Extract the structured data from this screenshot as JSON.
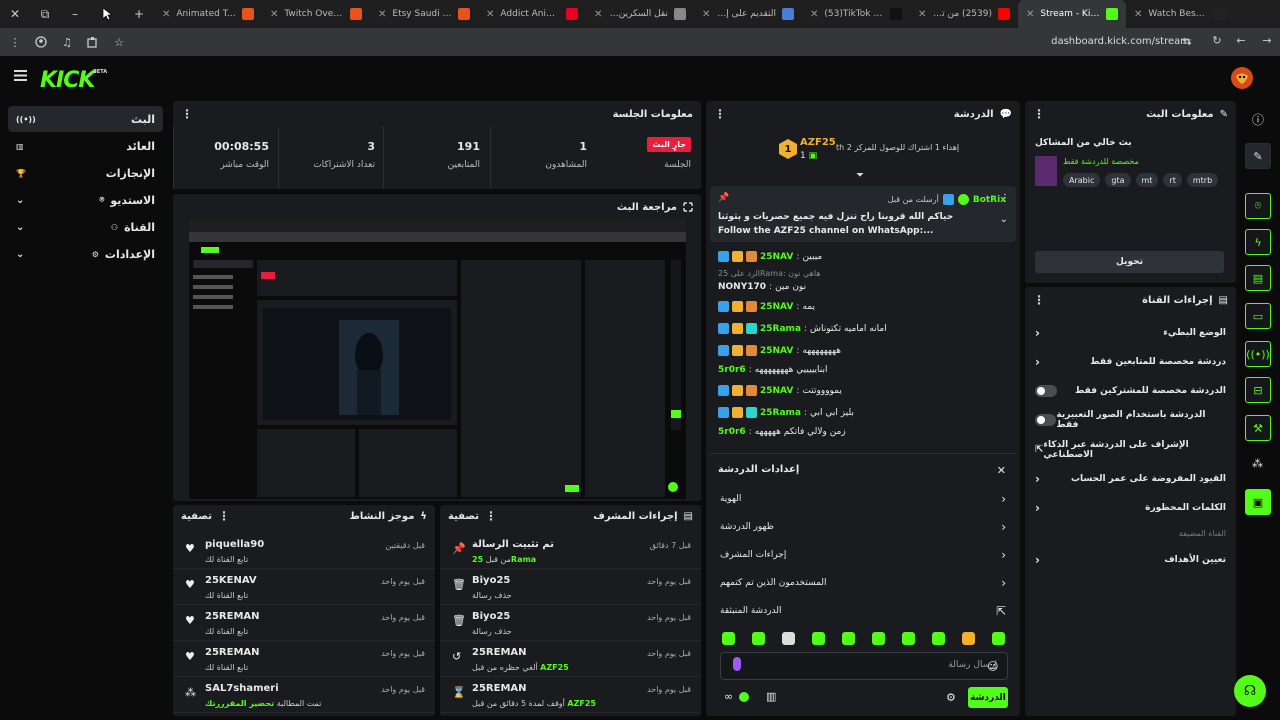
{
  "browser": {
    "tabs": [
      {
        "title": "Animated Twitch",
        "fav": "#e8521b",
        "active": false,
        "ltr": true
      },
      {
        "title": "Twitch Overlays -",
        "fav": "#e8521b",
        "active": false,
        "ltr": true
      },
      {
        "title": "Etsy Saudi Arabia",
        "fav": "#e8521b",
        "active": false,
        "ltr": true
      },
      {
        "title": "Addict Animated",
        "fav": "#e60023",
        "active": false,
        "ltr": true
      },
      {
        "title": "نقل السكرين للشا",
        "fav": "#888888",
        "active": false,
        "ltr": false
      },
      {
        "title": "التقديم على إدارة",
        "fav": "#4a7dd8",
        "active": false,
        "ltr": false
      },
      {
        "title": "(53)TikTok - Make",
        "fav": "#111111",
        "active": false,
        "ltr": true
      },
      {
        "title": "(2539) من تهمة الـ",
        "fav": "#ff0000",
        "active": false,
        "ltr": false
      },
      {
        "title": "Stream - Kick Da",
        "fav": "#53fc18",
        "active": true,
        "ltr": true
      },
      {
        "title": "Watch Best New M",
        "fav": "#222222",
        "active": false,
        "ltr": true
      }
    ],
    "url": "dashboard.kick.com/stream"
  },
  "header": {
    "logo": "KICK",
    "beta": "BETA"
  },
  "nav": {
    "items": [
      {
        "label": "البث",
        "icon": "broadcast-icon",
        "active": true
      },
      {
        "label": "العائد",
        "icon": "wallet-icon",
        "active": false
      },
      {
        "label": "الإنجازات",
        "icon": "trophy-icon",
        "active": false
      },
      {
        "label": "الاستديو",
        "icon": "studio-icon",
        "active": false,
        "expand": true
      },
      {
        "label": "القناة",
        "icon": "channel-icon",
        "active": false,
        "expand": true
      },
      {
        "label": "الإعدادات",
        "icon": "gear-icon",
        "active": false,
        "expand": true
      }
    ]
  },
  "session": {
    "title": "معلومات الجلسة",
    "live_badge": "جارٍ البث",
    "session_label": "الجلسة",
    "stats": [
      {
        "value": "1",
        "label": "المشاهدون"
      },
      {
        "value": "191",
        "label": "المتابعين"
      },
      {
        "value": "3",
        "label": "تعداد الاشتراكات"
      },
      {
        "value": "00:08:55",
        "label": "الوقت مباشر"
      }
    ]
  },
  "preview": {
    "title": "مراجعة البث"
  },
  "activity": {
    "title": "موجز النشاط",
    "filter": "تصفية",
    "items": [
      {
        "name": "piquella90",
        "sub": "تابع القناة لك",
        "time": "قبل دقيقتين",
        "icon": "heart-icon"
      },
      {
        "name": "25KENAV",
        "sub": "تابع القناة لك",
        "time": "قبل يوم واحد",
        "icon": "heart-icon"
      },
      {
        "name": "25REMAN",
        "sub": "تابع القناة لك",
        "time": "قبل يوم واحد",
        "icon": "heart-icon"
      },
      {
        "name": "25REMAN",
        "sub": "تابع القناة لك",
        "time": "قبل يوم واحد",
        "icon": "heart-icon"
      },
      {
        "name": "SAL7shameri",
        "sub": "تمت المطالبة",
        "sub_green": "تحضير المقرررتك",
        "time": "قبل يوم واحد",
        "icon": "points-icon"
      }
    ]
  },
  "mod": {
    "title": "إجراءات المشرف",
    "filter": "تصفية",
    "items": [
      {
        "name": "تم تثبيت الرسالة",
        "sub": "من قبل",
        "sub_green": "25Rama",
        "time": "قبل 7 دقائق",
        "icon": "pin-icon"
      },
      {
        "name": "Biyo25",
        "sub": "حذف رسالة",
        "sub_green": "",
        "time": "قبل يوم واحد",
        "icon": "trash-icon"
      },
      {
        "name": "Biyo25",
        "sub": "حذف رسالة",
        "sub_green": "",
        "time": "قبل يوم واحد",
        "icon": "trash-icon"
      },
      {
        "name": "25REMAN",
        "sub": "ألغي حظره من قبل",
        "sub_green": "AZF25",
        "time": "قبل يوم واحد",
        "icon": "unban-icon"
      },
      {
        "name": "25REMAN",
        "sub": "أوقف لمدة 5 دقائق من قبل",
        "sub_green": "AZF25",
        "time": "قبل يوم واحد",
        "icon": "hourglass-icon"
      }
    ]
  },
  "chat": {
    "title": "الدردشة",
    "leader_name": "AZF25",
    "leader_rank": "1",
    "leader_count": "1",
    "gift_text": "th إهداء 1 اشتراك للوصول للمركز 2",
    "pinned_sender": "BotRix",
    "pinned_by": "أرسلت من قبل",
    "pinned_text": "حياكم الله قروبنا راح تنزل فيه جميع حصريات و بثوثنا Follow the AZF25 channel on WhatsApp:...",
    "messages": [
      {
        "user": "25NAV",
        "text": "ميبين",
        "color": "#53fc18"
      },
      {
        "reply": "الرد على 25Rama: هاهي نون"
      },
      {
        "user": "NONY170",
        "text": "نون مين",
        "color": "#e8e8e8",
        "plain": true
      },
      {
        "user": "25NAV",
        "text": "يمه",
        "color": "#53fc18"
      },
      {
        "user": "25Rama",
        "text": "امانه اماميه تكتوناش",
        "color": "#53fc18"
      },
      {
        "user": "25NAV",
        "text": "ههههههههه",
        "color": "#53fc18"
      },
      {
        "user": "5r0r6",
        "text": "ابنايييييي ههههههههه",
        "color": "#53fc18",
        "plain": true
      },
      {
        "user": "25NAV",
        "text": "يمووووتتت",
        "color": "#53fc18"
      },
      {
        "user": "25Rama",
        "text": "بليز ابي ابي",
        "color": "#53fc18"
      },
      {
        "user": "5r0r6",
        "text": "زمن ولالي فاتكم هههههه",
        "color": "#53fc18",
        "plain": true
      }
    ],
    "settings_title": "إعدادات الدردشة",
    "settings_items": [
      {
        "label": "الهوية",
        "icon": "chevron-icon"
      },
      {
        "label": "ظهور الدردشة",
        "icon": "chevron-icon"
      },
      {
        "label": "إجراءات المشرف",
        "icon": "chevron-icon"
      },
      {
        "label": "المستخدمون الذين تم كتمهم",
        "icon": "chevron-icon"
      },
      {
        "label": "الدردشة المنبثقة",
        "icon": "popout-icon"
      }
    ],
    "input_placeholder": "إرسال رسالة",
    "send_label": "الدردشة"
  },
  "stream_info": {
    "title": "معلومات البث",
    "stream_title": "بث خالي من المشاكل",
    "category": "مخصصة للدردشة فقط",
    "tags": [
      "Arabic",
      "gta",
      "mt",
      "rt",
      "mtrb"
    ],
    "edit_label": "تحويل"
  },
  "channel_actions": {
    "title": "إجراءات القناة",
    "rows": [
      {
        "label": "الوضع البطيء",
        "control": "chevron"
      },
      {
        "label": "دردشة مخصصة للمتابعين فقط",
        "control": "chevron"
      },
      {
        "label": "الدردشة مخصصة للمشتركين فقط",
        "control": "toggle"
      },
      {
        "label": "الدردشة باستخدام الصور التعبيرية فقط",
        "control": "toggle"
      },
      {
        "label": "الإشراف على الدردشة عبر الذكاء الاصطناعي",
        "control": "external"
      },
      {
        "label": "القيود المفروضة على عمر الحساب",
        "control": "chevron"
      },
      {
        "label": "الكلمات المحظورة",
        "control": "chevron"
      }
    ],
    "hosted_label": "القناة المضيفة",
    "goals_label": "تعيين الأهداف"
  },
  "colors": {
    "accent": "#53fc18",
    "live": "#e91e3c",
    "panel": "#191b1f",
    "bg": "#0b0b0c"
  }
}
